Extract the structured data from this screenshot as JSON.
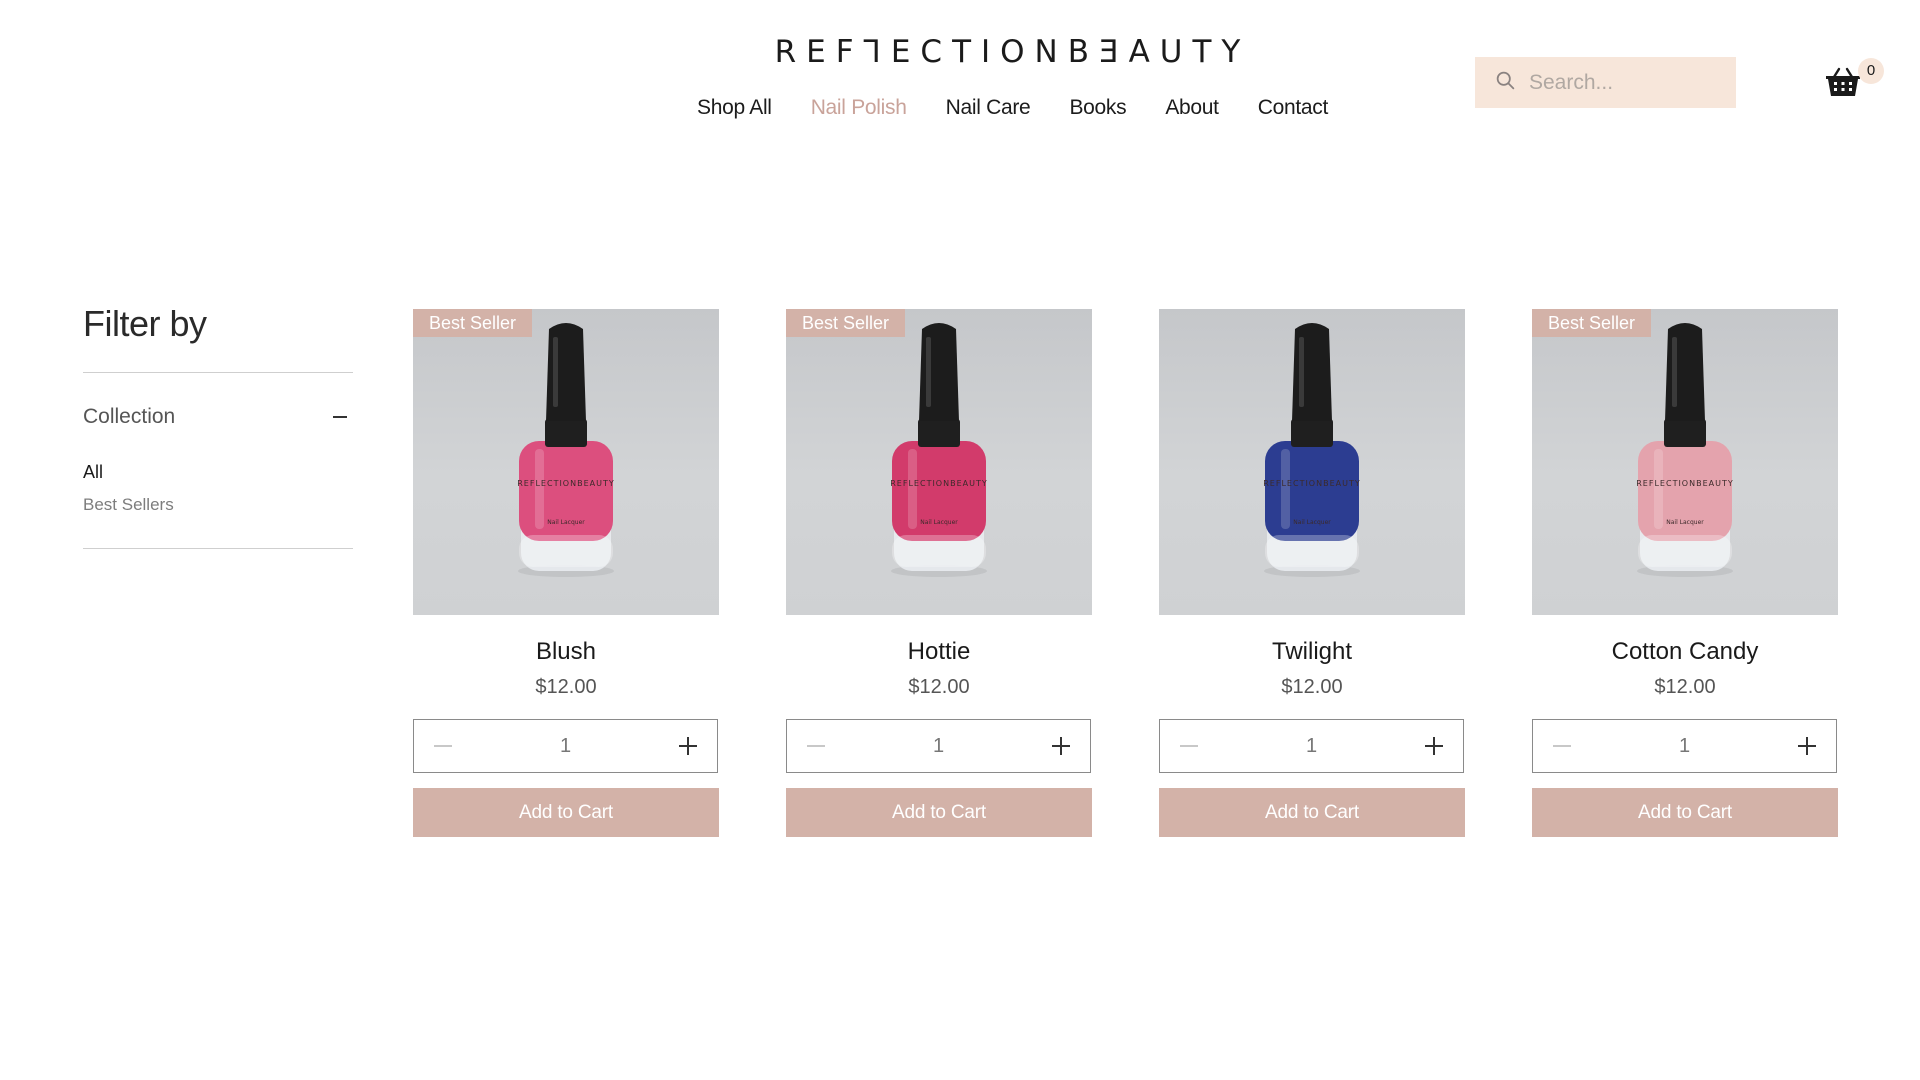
{
  "header": {
    "logo": "REF⅂ECTIONBƎAUTY",
    "nav": [
      {
        "label": "Shop All",
        "active": false
      },
      {
        "label": "Nail Polish",
        "active": true
      },
      {
        "label": "Nail Care",
        "active": false
      },
      {
        "label": "Books",
        "active": false
      },
      {
        "label": "About",
        "active": false
      },
      {
        "label": "Contact",
        "active": false
      }
    ],
    "search": {
      "placeholder": "Search...",
      "icon": "search-icon"
    },
    "cart": {
      "icon": "basket-icon",
      "count": "0"
    }
  },
  "sidebar": {
    "title": "Filter by",
    "collection": {
      "label": "Collection",
      "options": [
        "All",
        "Best Sellers"
      ],
      "selected": "All"
    }
  },
  "products": [
    {
      "name": "Blush",
      "price": "$12.00",
      "badge": "Best Seller",
      "quantity": "1",
      "button": "Add to Cart",
      "color": "#dc4f7e"
    },
    {
      "name": "Hottie",
      "price": "$12.00",
      "badge": "Best Seller",
      "quantity": "1",
      "button": "Add to Cart",
      "color": "#d23b6b"
    },
    {
      "name": "Twilight",
      "price": "$12.00",
      "badge": "",
      "quantity": "1",
      "button": "Add to Cart",
      "color": "#2c3d91"
    },
    {
      "name": "Cotton Candy",
      "price": "$12.00",
      "badge": "Best Seller",
      "quantity": "1",
      "button": "Add to Cart",
      "color": "#e4a3ad"
    }
  ],
  "colors": {
    "accent": "#d3b2a8",
    "active_nav": "#c9a39a",
    "search_bg": "#f7e6da"
  }
}
